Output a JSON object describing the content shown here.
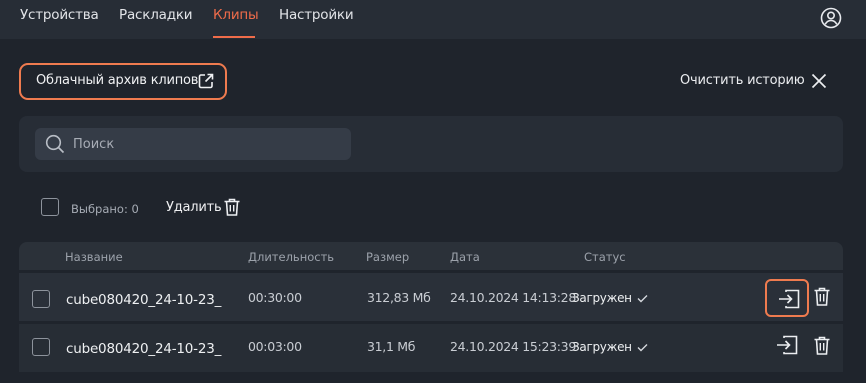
{
  "nav": {
    "tabs": [
      "Устройства",
      "Раскладки",
      "Клипы",
      "Настройки"
    ],
    "active_tab": "Клипы",
    "accent_color": "#ef6c4a"
  },
  "toolbar": {
    "cloud_archive_label": "Облачный архив клипов",
    "clear_history_label": "Очистить историю"
  },
  "search": {
    "placeholder": "Поиск",
    "value": ""
  },
  "selection": {
    "selected_label": "Выбрано: 0",
    "delete_label": "Удалить"
  },
  "table": {
    "columns": [
      "Название",
      "Длительность",
      "Размер",
      "Дата",
      "Статус"
    ],
    "rows": [
      {
        "name": "cube080420_24-10-23_",
        "duration": "00:30:00",
        "size": "312,83 Мб",
        "date": "24.10.2024 14:13:28",
        "status": "Загружен"
      },
      {
        "name": "cube080420_24-10-23_",
        "duration": "00:03:00",
        "size": "31,1 Мб",
        "date": "24.10.2024 15:23:39",
        "status": "Загружен"
      }
    ]
  },
  "icons": [
    "user-circle-icon",
    "external-link-icon",
    "close-icon",
    "search-icon",
    "trash-icon",
    "export-icon",
    "check-icon"
  ]
}
